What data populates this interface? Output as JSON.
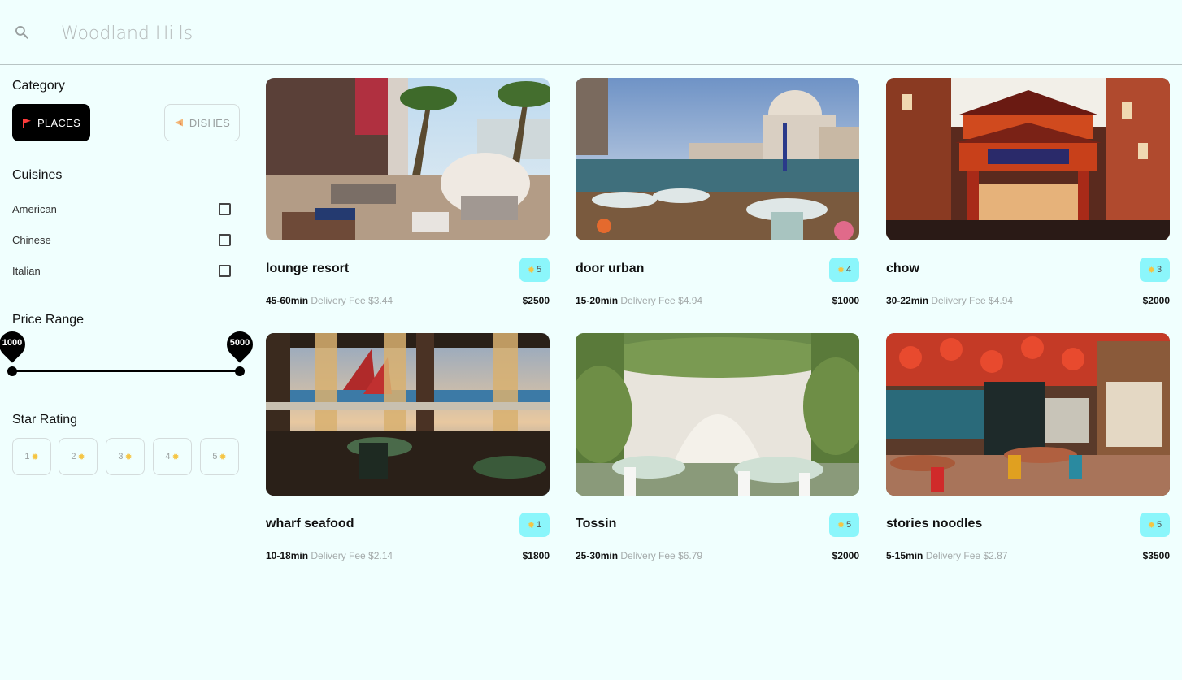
{
  "search": {
    "placeholder": "Woodland Hills",
    "value": ""
  },
  "sidebar": {
    "category_title": "Category",
    "categories": [
      {
        "label": "PLACES",
        "icon": "flag-icon",
        "selected": true
      },
      {
        "label": "DISHES",
        "icon": "pizza-icon",
        "selected": false
      }
    ],
    "cuisines_title": "Cuisines",
    "cuisines": [
      {
        "label": "American",
        "checked": false
      },
      {
        "label": "Chinese",
        "checked": false
      },
      {
        "label": "Italian",
        "checked": false
      }
    ],
    "price_title": "Price Range",
    "price_min": "1000",
    "price_max": "5000",
    "star_title": "Star Rating",
    "stars": [
      "1",
      "2",
      "3",
      "4",
      "5"
    ]
  },
  "colors": {
    "background": "#f0fffe",
    "badge": "#8bf6fb",
    "accent": "#000000",
    "sun": "#f5c542"
  },
  "restaurants": [
    {
      "name": "lounge resort",
      "rating": "5",
      "time": "45-60min",
      "fee": "Delivery Fee $3.44",
      "price": "$2500"
    },
    {
      "name": "door urban",
      "rating": "4",
      "time": "15-20min",
      "fee": "Delivery Fee $4.94",
      "price": "$1000"
    },
    {
      "name": "chow",
      "rating": "3",
      "time": "30-22min",
      "fee": "Delivery Fee $4.94",
      "price": "$2000"
    },
    {
      "name": "wharf seafood",
      "rating": "1",
      "time": "10-18min",
      "fee": "Delivery Fee $2.14",
      "price": "$1800"
    },
    {
      "name": "Tossin",
      "rating": "5",
      "time": "25-30min",
      "fee": "Delivery Fee $6.79",
      "price": "$2000"
    },
    {
      "name": "stories noodles",
      "rating": "5",
      "time": "5-15min",
      "fee": "Delivery Fee $2.87",
      "price": "$3500"
    }
  ]
}
